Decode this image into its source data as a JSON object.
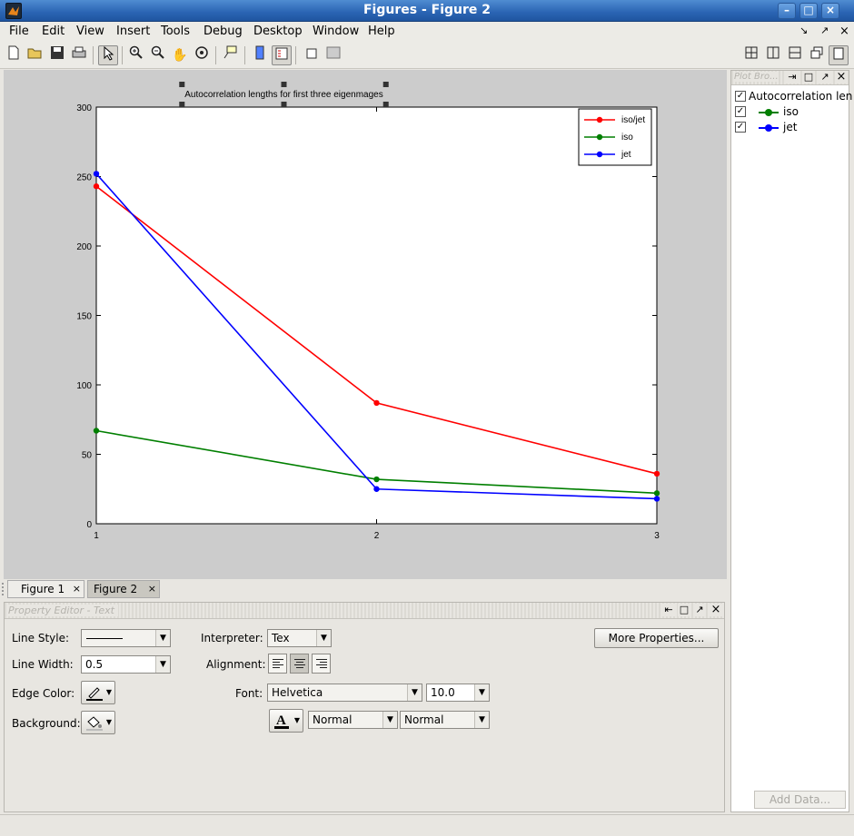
{
  "window": {
    "title": "Figures - Figure 2",
    "controls": [
      "↘",
      "↗",
      "×"
    ]
  },
  "menubar": {
    "items": [
      "File",
      "Edit",
      "View",
      "Insert",
      "Tools",
      "Debug",
      "Desktop",
      "Window",
      "Help"
    ]
  },
  "figure_tabs": [
    {
      "label": "Figure 1",
      "selected": false
    },
    {
      "label": "Figure 2",
      "selected": true
    }
  ],
  "plot_browser": {
    "title": "Plot Bro...",
    "items": [
      {
        "label": "Autocorrelation len",
        "checked": true,
        "color": "#000000",
        "type": "axes"
      },
      {
        "label": "iso",
        "checked": true,
        "color": "#007f00",
        "type": "line"
      },
      {
        "label": "jet",
        "checked": true,
        "color": "#0000ff",
        "type": "line"
      }
    ],
    "add_data_label": "Add Data..."
  },
  "property_editor": {
    "title": "Property Editor - Text",
    "line_style_label": "Line Style:",
    "line_width_label": "Line Width:",
    "line_width_value": "0.5",
    "edge_color_label": "Edge Color:",
    "background_label": "Background:",
    "interpreter_label": "Interpreter:",
    "interpreter_value": "Tex",
    "alignment_label": "Alignment:",
    "font_label": "Font:",
    "font_value": "Helvetica",
    "font_size_value": "10.0",
    "font_weight_value": "Normal",
    "font_angle_value": "Normal",
    "more_properties_label": "More Properties..."
  },
  "chart_data": {
    "type": "line",
    "title": "Autocorrelation lengths for first three eigenmages",
    "x": [
      1,
      2,
      3
    ],
    "xticks": [
      "1",
      "2",
      "3"
    ],
    "ylim": [
      0,
      300
    ],
    "yticks": [
      "0",
      "50",
      "100",
      "150",
      "200",
      "250",
      "300"
    ],
    "xlabel": "",
    "ylabel": "",
    "legend_position": "top-right",
    "grid": false,
    "series": [
      {
        "name": "iso/jet",
        "color": "#ff0000",
        "values": [
          243,
          87,
          36
        ]
      },
      {
        "name": "iso",
        "color": "#007f00",
        "values": [
          67,
          32,
          22
        ]
      },
      {
        "name": "jet",
        "color": "#0000ff",
        "values": [
          252,
          25,
          18
        ]
      }
    ]
  }
}
